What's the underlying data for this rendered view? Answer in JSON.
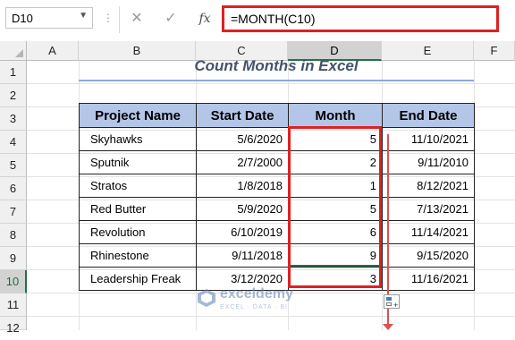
{
  "formula_bar": {
    "name_box": "D10",
    "formula": "=MONTH(C10)",
    "cancel_icon": "✕",
    "enter_icon": "✓",
    "fx_label": "fx"
  },
  "columns": [
    "A",
    "B",
    "C",
    "D",
    "E",
    "F"
  ],
  "rows": [
    "1",
    "2",
    "3",
    "4",
    "5",
    "6",
    "7",
    "8",
    "9",
    "10",
    "11",
    "12"
  ],
  "selected_column": "D",
  "selected_row": "10",
  "title": "Count Months in Excel",
  "table": {
    "headers": [
      "Project Name",
      "Start Date",
      "Month",
      "End Date"
    ],
    "rows": [
      [
        "Skyhawks",
        "5/6/2020",
        "5",
        "11/10/2021"
      ],
      [
        "Sputnik",
        "2/7/2000",
        "2",
        "9/11/2010"
      ],
      [
        "Stratos",
        "1/8/2018",
        "1",
        "8/12/2021"
      ],
      [
        "Red Butter",
        "5/9/2020",
        "5",
        "7/13/2021"
      ],
      [
        "Revolution",
        "6/10/2019",
        "6",
        "11/14/2021"
      ],
      [
        "Rhinestone",
        "9/11/2018",
        "9",
        "9/15/2020"
      ],
      [
        "Leadership Freak",
        "3/12/2020",
        "3",
        "11/16/2021"
      ]
    ]
  },
  "watermark": {
    "name": "exceldemy",
    "tagline": "EXCEL · DATA · BI"
  },
  "colors": {
    "header_fill": "#b4c6e7",
    "highlight_red": "#e02020",
    "title_color": "#44546a",
    "excel_green": "#217346"
  }
}
